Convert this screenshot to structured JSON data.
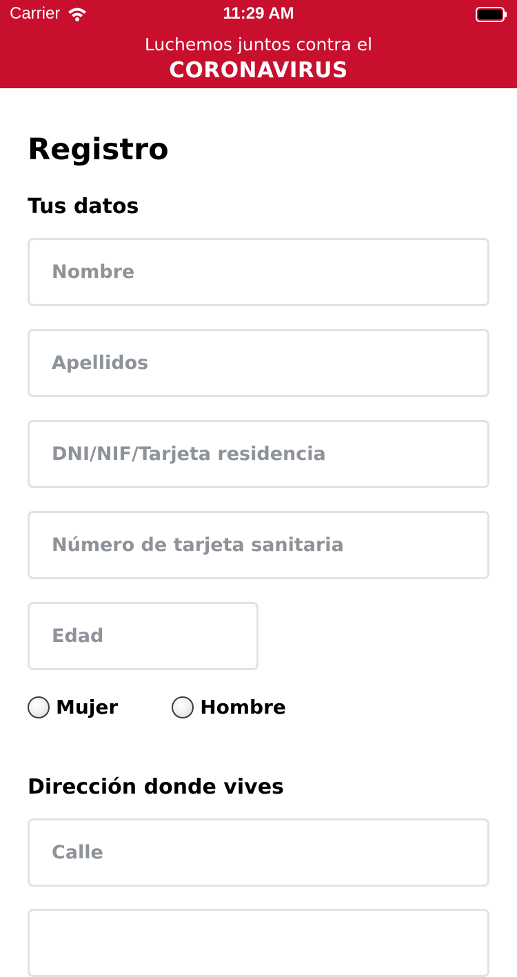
{
  "status_bar": {
    "carrier": "Carrier",
    "time": "11:29 AM",
    "icons": [
      "wifi-icon",
      "battery-icon"
    ]
  },
  "header": {
    "tagline": "Luchemos juntos contra el",
    "brand": "CORONAVIRUS",
    "background_color": "#c8102e"
  },
  "page": {
    "title": "Registro"
  },
  "personal": {
    "section_title": "Tus datos",
    "nombre_placeholder": "Nombre",
    "apellidos_placeholder": "Apellidos",
    "dni_placeholder": "DNI/NIF/Tarjeta residencia",
    "tarjeta_sanitaria_placeholder": "Número de tarjeta sanitaria",
    "edad_placeholder": "Edad",
    "gender_options": [
      {
        "label": "Mujer",
        "selected": false
      },
      {
        "label": "Hombre",
        "selected": false
      }
    ]
  },
  "address": {
    "section_title": "Dirección donde vives",
    "calle_placeholder": "Calle",
    "next_placeholder": ""
  }
}
